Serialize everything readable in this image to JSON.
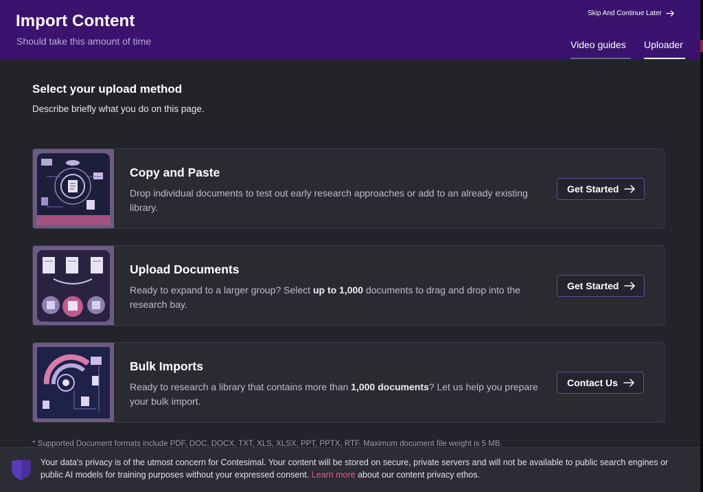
{
  "header": {
    "title": "Import Content",
    "subtitle": "Should take this amount of time",
    "skip_label": "Skip And Continue Later",
    "tabs": [
      {
        "label": "Video guides",
        "active": false
      },
      {
        "label": "Uploader",
        "active": true
      }
    ]
  },
  "section": {
    "title": "Select your upload method",
    "description": "Describe briefly what you do on this page."
  },
  "cards": [
    {
      "title": "Copy and Paste",
      "desc_before": "Drop individual documents to test out early research approaches or add to an already existing library.",
      "desc_bold": "",
      "desc_after": "",
      "button": "Get Started"
    },
    {
      "title": "Upload Documents",
      "desc_before": "Ready to expand to a larger group? Select ",
      "desc_bold": "up to 1,000",
      "desc_after": " documents to drag and drop into the research bay.",
      "button": "Get Started"
    },
    {
      "title": "Bulk Imports",
      "desc_before": "Ready to research a library that contains more than ",
      "desc_bold": "1,000 documents",
      "desc_after": "? Let us help you prepare your bulk import.",
      "button": "Contact Us"
    }
  ],
  "footnote": "* Supported Document formats include PDF, DOC, DOCX, TXT, XLS, XLSX, PPT, PPTX, RTF. Maximum document file weight is 5 MB.",
  "privacy": {
    "text_before": "Your data's privacy is of the utmost concern for Contesimal. Your content will be stored on secure, private servers and will not be available to public search engines or public AI models for training purposes without your expressed consent. ",
    "link": "Learn more",
    "text_after": " about our content privacy ethos."
  },
  "icons": {
    "skip": "arrow-right-icon",
    "button": "arrow-right-icon",
    "privacy": "shield-icon"
  },
  "colors": {
    "header_bg": "#3a136e",
    "body_bg": "#22242a",
    "card_bg": "#2a2b31",
    "button_border": "#5b4f9a",
    "link": "#e0607b"
  }
}
